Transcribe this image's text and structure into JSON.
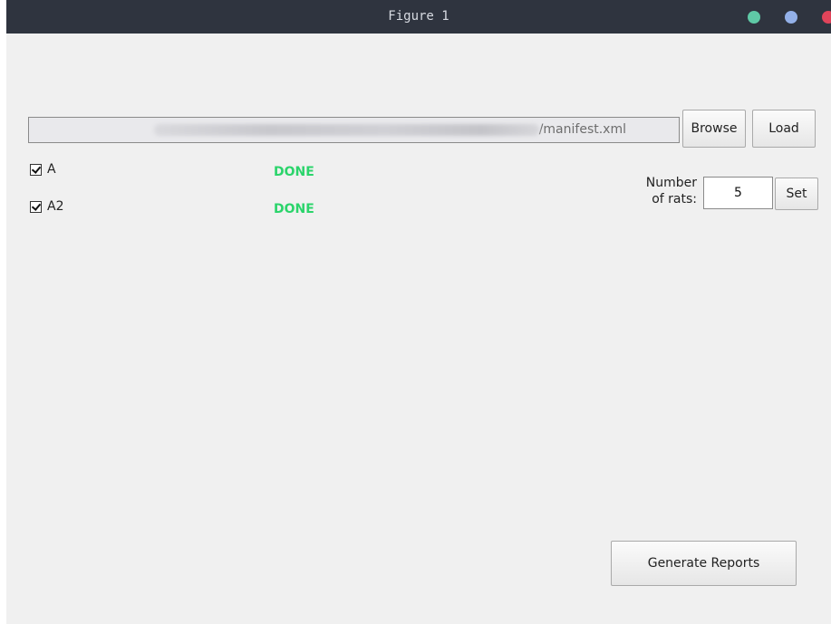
{
  "window": {
    "title": "Figure 1",
    "controls": {
      "minimize_color": "#5fc9a6",
      "maximize_color": "#93b0e8",
      "close_color": "#e0445a"
    }
  },
  "file": {
    "path_value": "/manifest.xml",
    "path_prefix_visible": false,
    "browse_label": "Browse",
    "load_label": "Load"
  },
  "items": [
    {
      "label": "A",
      "checked": true,
      "status": "DONE",
      "status_color": "#2bd46b"
    },
    {
      "label": "A2",
      "checked": true,
      "status": "DONE",
      "status_color": "#2bd46b"
    }
  ],
  "rats": {
    "label_line1": "Number",
    "label_line2": "of rats:",
    "value": "5",
    "set_label": "Set"
  },
  "actions": {
    "generate_label": "Generate Reports"
  }
}
